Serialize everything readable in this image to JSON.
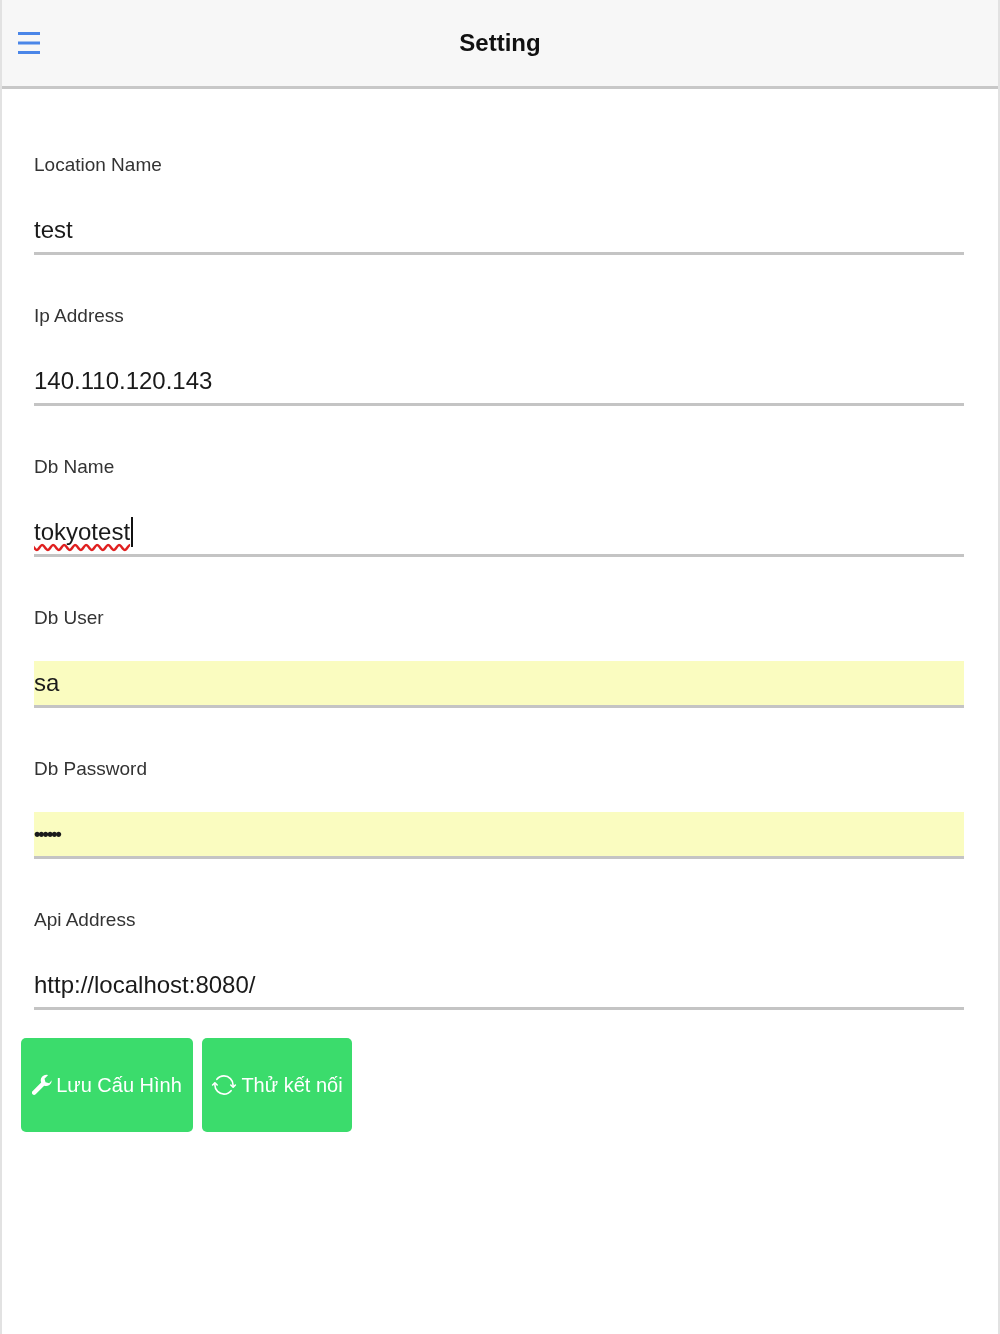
{
  "header": {
    "title": "Setting"
  },
  "fields": [
    {
      "label": "Location Name",
      "value": "test",
      "kind": "text",
      "autofilled": false,
      "focused": false,
      "spell_error": false
    },
    {
      "label": "Ip Address",
      "value": "140.110.120.143",
      "kind": "text",
      "autofilled": false,
      "focused": false,
      "spell_error": false
    },
    {
      "label": "Db Name",
      "value": "tokyotest",
      "kind": "text",
      "autofilled": false,
      "focused": true,
      "spell_error": true
    },
    {
      "label": "Db User",
      "value": "sa",
      "kind": "text",
      "autofilled": true,
      "focused": false,
      "spell_error": false
    },
    {
      "label": "Db Password",
      "value": "••••••",
      "kind": "password",
      "autofilled": true,
      "focused": false,
      "spell_error": false
    },
    {
      "label": "Api Address",
      "value": "http://localhost:8080/",
      "kind": "text",
      "autofilled": false,
      "focused": false,
      "spell_error": false
    }
  ],
  "buttons": [
    {
      "kind": "save",
      "label": "Lưu Cấu Hình"
    },
    {
      "kind": "test",
      "label": "Thử kết nối"
    }
  ]
}
